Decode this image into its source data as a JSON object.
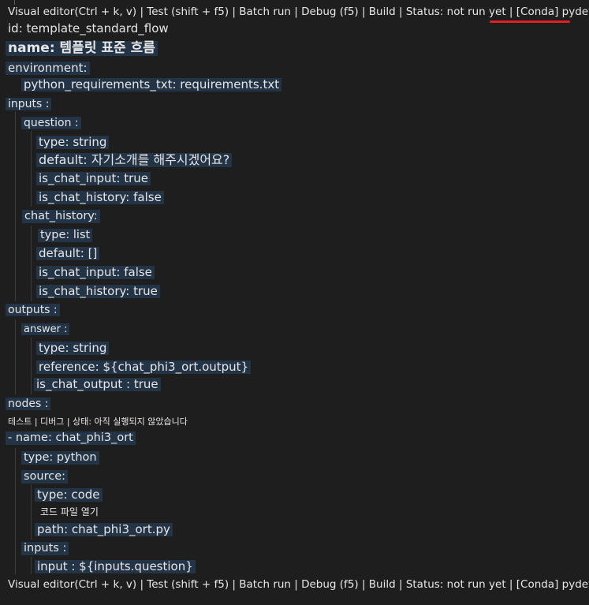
{
  "codelens_top": "Visual editor(Ctrl + k, v) | Test (shift + f5) | Batch run | Debug (f5) | Build | Status: not run yet | [Conda] pydev",
  "codelens_bottom": "Visual editor(Ctrl + k, v) | Test (shift + f5) | Batch run | Debug (f5) | Build | Status: not run yet | [Conda] pydev",
  "codelens_nodes": "테스트 | 디버그 | 상태: 아직 실행되지 않았습니다",
  "codelens_open_code": "코드 파일 열기",
  "lines": {
    "id": "id: template_standard_flow",
    "name": "name: 템플릿 표준 흐름",
    "environment": "environment:",
    "python_req": "python_requirements_txt: requirements.txt",
    "inputs": "inputs :",
    "question": "question :",
    "q_type": "type: string",
    "q_default": "default: 자기소개를 해주시겠어요?",
    "q_is_chat_input": "is_chat_input: true",
    "q_is_chat_history": "is_chat_history: false",
    "chat_history": "chat_history:",
    "ch_type": "type: list",
    "ch_default": "default: []",
    "ch_is_chat_input": "is_chat_input: false",
    "ch_is_chat_history": "is_chat_history: true",
    "outputs": "outputs :",
    "answer": "answer :",
    "a_type": "type: string",
    "a_reference": "reference: ${chat_phi3_ort.output}",
    "a_is_chat_output": "is_chat_output : true",
    "nodes": "nodes :",
    "node_name": "- name: chat_phi3_ort",
    "node_type": "type: python",
    "source": "source:",
    "src_type": "type: code",
    "src_path": "path: chat_phi3_ort.py",
    "node_inputs": "inputs :",
    "node_input": "input : ${inputs.question}"
  },
  "colors": {
    "background": "#1e1e1e",
    "line_highlight": "#243447",
    "text": "#e6e6e6",
    "annotation_underline": "#e02020"
  }
}
